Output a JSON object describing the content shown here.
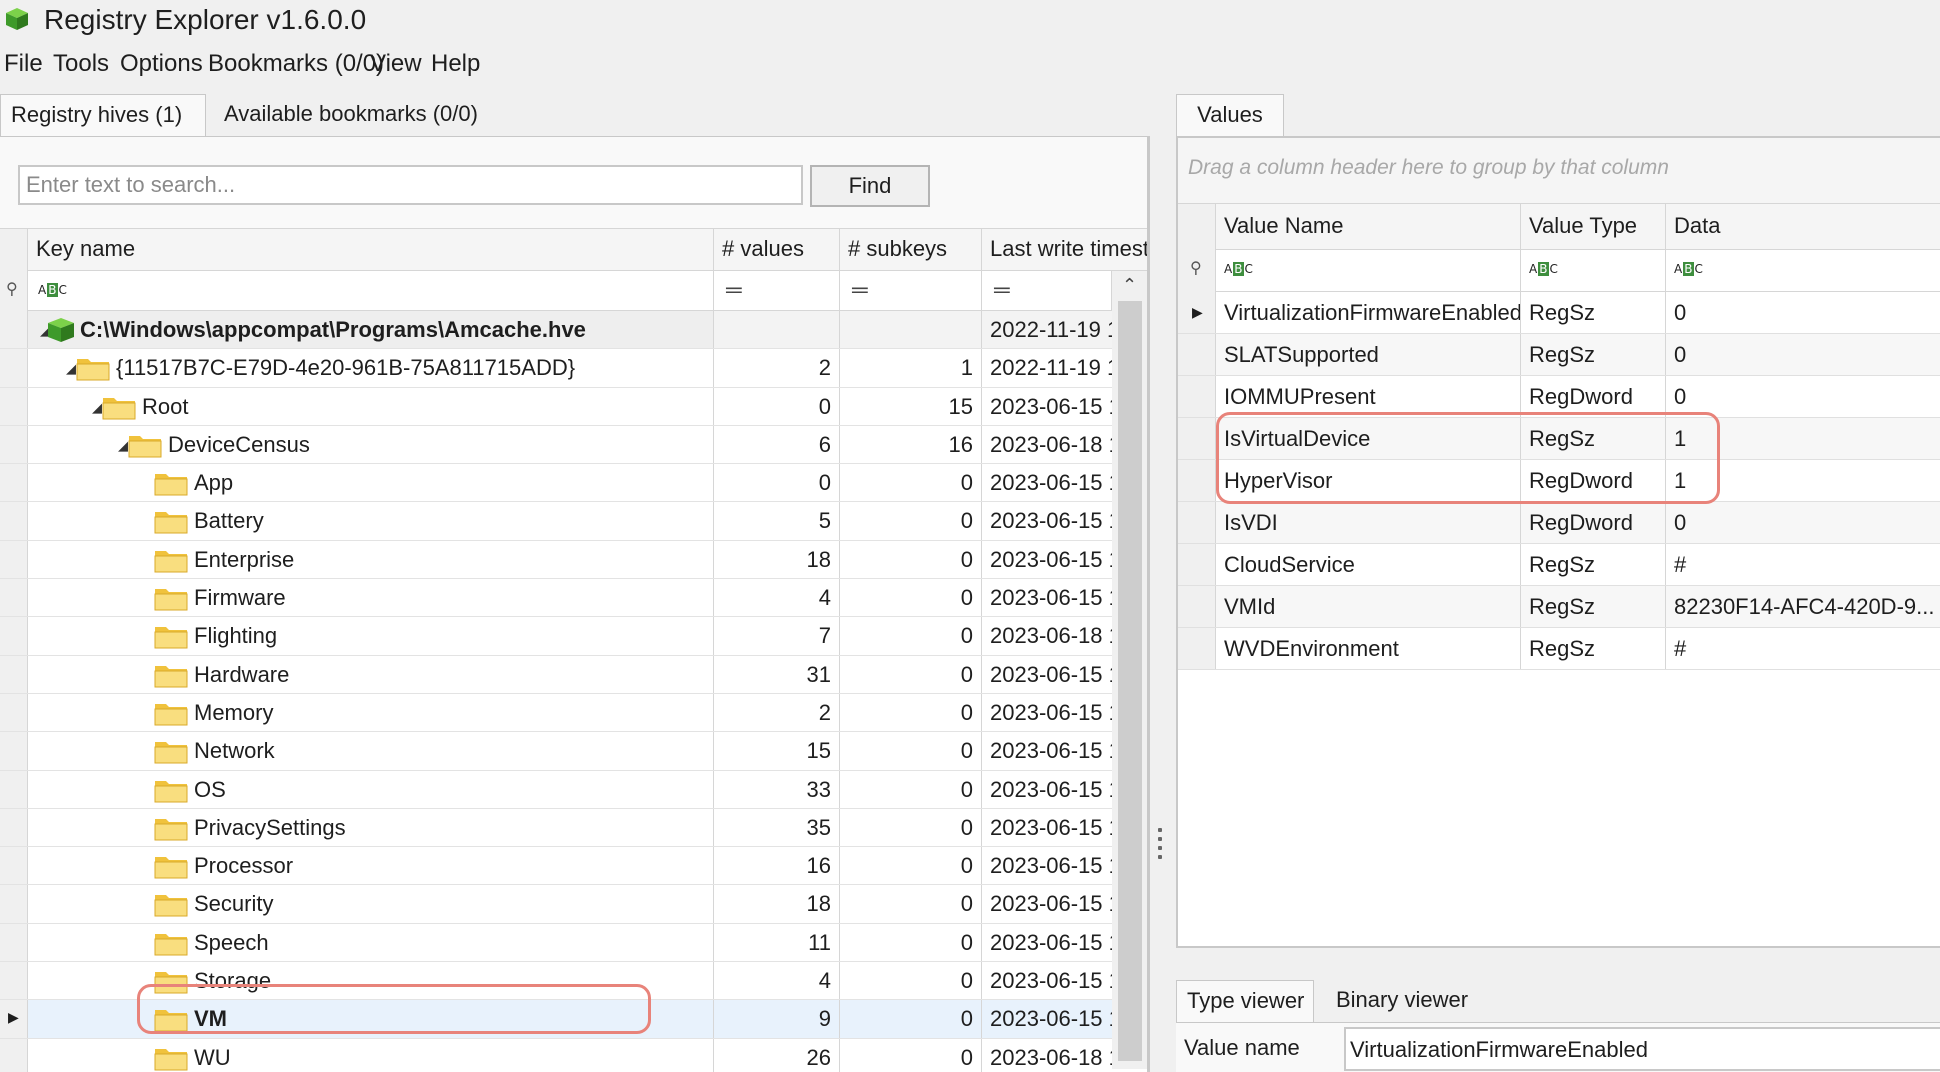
{
  "app": {
    "title": "Registry Explorer v1.6.0.0",
    "icon": "green-cube-icon"
  },
  "menu": [
    "File",
    "Tools",
    "Options",
    "Bookmarks (0/0)",
    "View",
    "Help"
  ],
  "left_tabs": [
    "Registry hives (1)",
    "Available bookmarks (0/0)"
  ],
  "search": {
    "placeholder": "Enter text to search...",
    "value": "",
    "find_label": "Find"
  },
  "tree_columns": [
    "Key name",
    "# values",
    "# subkeys",
    "Last write timesta"
  ],
  "tree_rows": [
    {
      "name": "C:\\Windows\\appcompat\\Programs\\Amcache.hve",
      "values": "",
      "subkeys": "",
      "ts": "2022-11-19 1",
      "level": 0,
      "kind": "hive",
      "expanded": true
    },
    {
      "name": "{11517B7C-E79D-4e20-961B-75A811715ADD}",
      "values": "2",
      "subkeys": "1",
      "ts": "2022-11-19 1",
      "level": 1,
      "kind": "folder",
      "expanded": true
    },
    {
      "name": "Root",
      "values": "0",
      "subkeys": "15",
      "ts": "2023-06-15 1",
      "level": 2,
      "kind": "folder",
      "expanded": true
    },
    {
      "name": "DeviceCensus",
      "values": "6",
      "subkeys": "16",
      "ts": "2023-06-18 1",
      "level": 3,
      "kind": "folder",
      "expanded": true
    },
    {
      "name": "App",
      "values": "0",
      "subkeys": "0",
      "ts": "2023-06-15 1",
      "level": 4,
      "kind": "folder"
    },
    {
      "name": "Battery",
      "values": "5",
      "subkeys": "0",
      "ts": "2023-06-15 1",
      "level": 4,
      "kind": "folder"
    },
    {
      "name": "Enterprise",
      "values": "18",
      "subkeys": "0",
      "ts": "2023-06-15 1",
      "level": 4,
      "kind": "folder"
    },
    {
      "name": "Firmware",
      "values": "4",
      "subkeys": "0",
      "ts": "2023-06-15 1",
      "level": 4,
      "kind": "folder"
    },
    {
      "name": "Flighting",
      "values": "7",
      "subkeys": "0",
      "ts": "2023-06-18 1",
      "level": 4,
      "kind": "folder"
    },
    {
      "name": "Hardware",
      "values": "31",
      "subkeys": "0",
      "ts": "2023-06-15 1",
      "level": 4,
      "kind": "folder"
    },
    {
      "name": "Memory",
      "values": "2",
      "subkeys": "0",
      "ts": "2023-06-15 1",
      "level": 4,
      "kind": "folder"
    },
    {
      "name": "Network",
      "values": "15",
      "subkeys": "0",
      "ts": "2023-06-15 1",
      "level": 4,
      "kind": "folder"
    },
    {
      "name": "OS",
      "values": "33",
      "subkeys": "0",
      "ts": "2023-06-15 1",
      "level": 4,
      "kind": "folder"
    },
    {
      "name": "PrivacySettings",
      "values": "35",
      "subkeys": "0",
      "ts": "2023-06-15 1",
      "level": 4,
      "kind": "folder"
    },
    {
      "name": "Processor",
      "values": "16",
      "subkeys": "0",
      "ts": "2023-06-15 1",
      "level": 4,
      "kind": "folder"
    },
    {
      "name": "Security",
      "values": "18",
      "subkeys": "0",
      "ts": "2023-06-15 1",
      "level": 4,
      "kind": "folder"
    },
    {
      "name": "Speech",
      "values": "11",
      "subkeys": "0",
      "ts": "2023-06-15 1",
      "level": 4,
      "kind": "folder"
    },
    {
      "name": "Storage",
      "values": "4",
      "subkeys": "0",
      "ts": "2023-06-15 1",
      "level": 4,
      "kind": "folder"
    },
    {
      "name": "VM",
      "values": "9",
      "subkeys": "0",
      "ts": "2023-06-15 1",
      "level": 4,
      "kind": "folder",
      "selected": true
    },
    {
      "name": "WU",
      "values": "26",
      "subkeys": "0",
      "ts": "2023-06-18 1",
      "level": 4,
      "kind": "folder"
    }
  ],
  "values_tab": "Values",
  "group_hint": "Drag a column header here to group by that column",
  "values_columns": [
    "Value Name",
    "Value Type",
    "Data"
  ],
  "values_rows": [
    {
      "name": "VirtualizationFirmwareEnabled",
      "type": "RegSz",
      "data": "0",
      "current": true
    },
    {
      "name": "SLATSupported",
      "type": "RegSz",
      "data": "0"
    },
    {
      "name": "IOMMUPresent",
      "type": "RegDword",
      "data": "0"
    },
    {
      "name": "IsVirtualDevice",
      "type": "RegSz",
      "data": "1"
    },
    {
      "name": "HyperVisor",
      "type": "RegDword",
      "data": "1"
    },
    {
      "name": "IsVDI",
      "type": "RegDword",
      "data": "0"
    },
    {
      "name": "CloudService",
      "type": "RegSz",
      "data": "#"
    },
    {
      "name": "VMId",
      "type": "RegSz",
      "data": "82230F14-AFC4-420D-9..."
    },
    {
      "name": "WVDEnvironment",
      "type": "RegSz",
      "data": "#"
    }
  ],
  "viewer_tabs": [
    "Type viewer",
    "Binary viewer"
  ],
  "viewer": {
    "label": "Value name",
    "value": "VirtualizationFirmwareEnabled"
  },
  "colors": {
    "highlight": "#e8837a",
    "folder": "#f5d467",
    "accent_green": "#3e8e3e",
    "selection": "#e8f2fc"
  }
}
